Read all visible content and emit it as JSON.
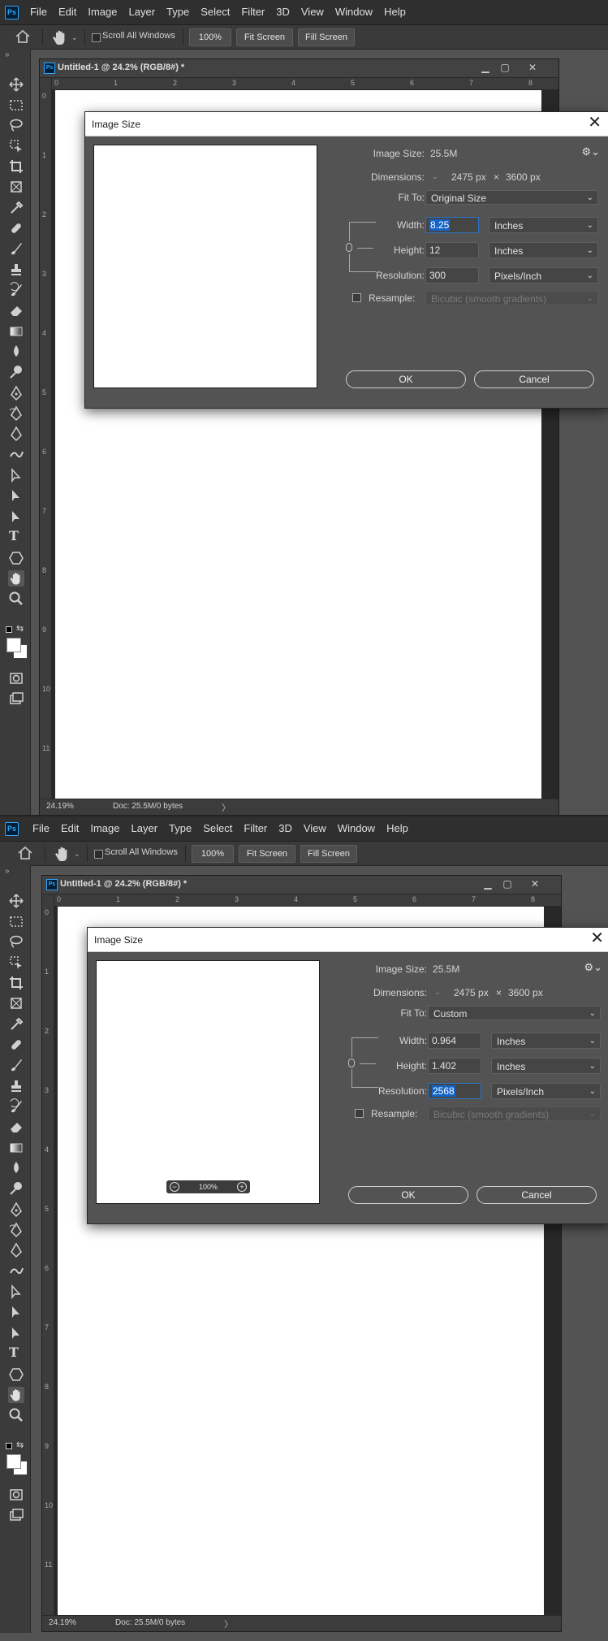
{
  "app": {
    "logo_text": "Ps",
    "menu": [
      "File",
      "Edit",
      "Image",
      "Layer",
      "Type",
      "Select",
      "Filter",
      "3D",
      "View",
      "Window",
      "Help"
    ]
  },
  "options_bar": {
    "scroll_all_windows": "Scroll All Windows",
    "zoom_button": "100%",
    "fit_screen": "Fit Screen",
    "fill_screen": "Fill Screen"
  },
  "document": {
    "title": "Untitled-1 @ 24.2% (RGB/8#) *",
    "ruler_h": [
      "0",
      "1",
      "2",
      "3",
      "4",
      "5",
      "6",
      "7",
      "8"
    ],
    "ruler_v": [
      "0",
      "1",
      "2",
      "3",
      "4",
      "5",
      "6",
      "7",
      "8",
      "9",
      "10",
      "11"
    ],
    "status_zoom": "24.19%",
    "status_doc": "Doc: 25.5M/0 bytes"
  },
  "dialog_common": {
    "title": "Image Size",
    "image_size_label": "Image Size:",
    "image_size_value": "25.5M",
    "dimensions_label": "Dimensions:",
    "dim_w": "2475 px",
    "dim_x": "×",
    "dim_h": "3600 px",
    "fit_to_label": "Fit To:",
    "width_label": "Width:",
    "height_label": "Height:",
    "resolution_label": "Resolution:",
    "resample_label": "Resample:",
    "resample_value": "Bicubic (smooth gradients)",
    "ok": "OK",
    "cancel": "Cancel",
    "unit_inches": "Inches",
    "unit_res": "Pixels/Inch"
  },
  "state1": {
    "fit_to": "Original Size",
    "width": "8.25",
    "height": "12",
    "resolution": "300"
  },
  "state2": {
    "fit_to": "Custom",
    "width": "0.964",
    "height": "1.402",
    "resolution": "2568",
    "preview_zoom": "100%"
  }
}
